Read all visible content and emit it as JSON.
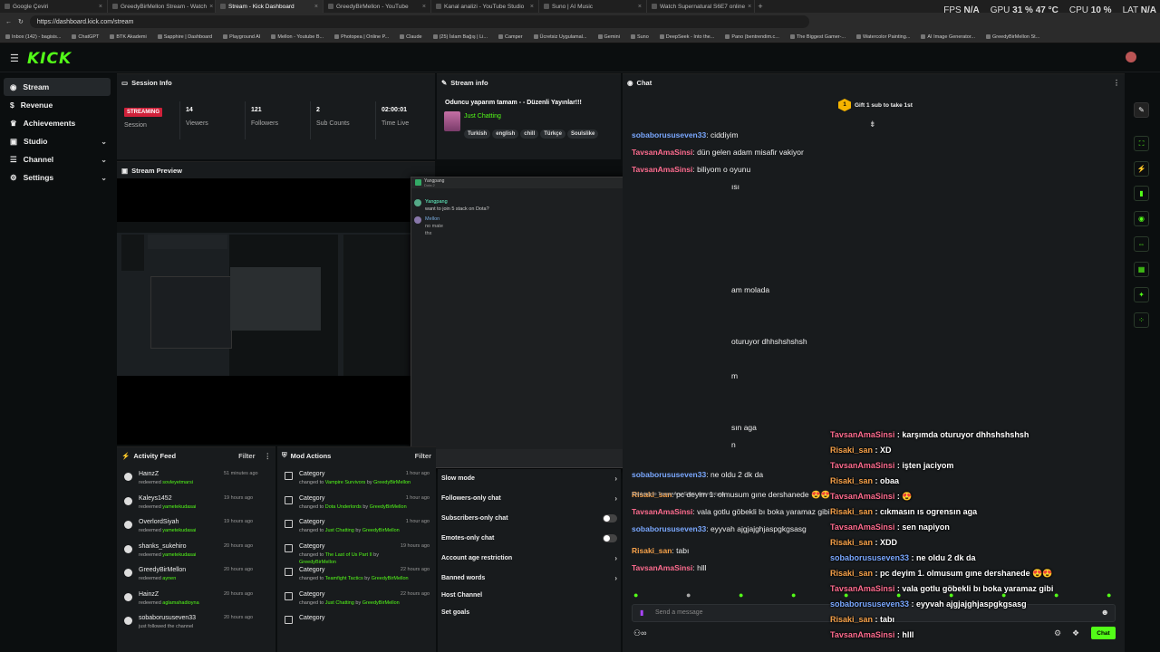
{
  "browser": {
    "tabs": [
      "Google Çeviri",
      "GreedyBirMellon Stream - Watch",
      "Stream - Kick Dashboard",
      "GreedyBirMellon - YouTube",
      "Kanal analizi - YouTube Studio",
      "Suno | AI Music",
      "Watch Supernatural S6E7 online"
    ],
    "url": "https://dashboard.kick.com/stream",
    "bookmarks": [
      "Inbox (142) - bagisis...",
      "ChatGPT",
      "BTK Akademi",
      "Sapphire | Dashboard",
      "Playground AI",
      "Mellon - Youtube B...",
      "Photopea | Online P...",
      "Claude",
      "(25) İslam Bağış | Li...",
      "Camper",
      "Ücretsiz Uygulamal...",
      "Gemini",
      "Suno",
      "DeepSeek - Into the...",
      "Pano (bentrendim.c...",
      "The Biggest Gamer-...",
      "Watercolor Painting...",
      "AI Image Generator...",
      "GreedyBirMellon St..."
    ],
    "perf": {
      "fps_label": "FPS",
      "fps": "N/A",
      "gpu_label": "GPU",
      "gpu": "31 % 47 °C",
      "cpu_label": "CPU",
      "cpu": "10 %",
      "lat_label": "LAT",
      "lat": "N/A"
    }
  },
  "app": {
    "logo": "KICK"
  },
  "sidebar": [
    {
      "label": "Stream",
      "icon": "broadcast-icon"
    },
    {
      "label": "Revenue",
      "icon": "revenue-icon"
    },
    {
      "label": "Achievements",
      "icon": "trophy-icon"
    },
    {
      "label": "Studio",
      "icon": "studio-icon"
    },
    {
      "label": "Channel",
      "icon": "channel-icon"
    },
    {
      "label": "Settings",
      "icon": "gear-icon"
    }
  ],
  "session": {
    "title": "Session Info",
    "status": "STREAMING",
    "status_label": "Session",
    "viewers": "14",
    "viewers_label": "Viewers",
    "followers": "121",
    "followers_label": "Followers",
    "subs": "2",
    "subs_label": "Sub Counts",
    "time": "02:00:01",
    "time_label": "Time Live"
  },
  "stream_info": {
    "title": "Stream info",
    "stream_title": "Oduncu yaparım tamam - - Düzenli Yayınlar!!!",
    "category": "Just Chatting",
    "tags": [
      "Turkish",
      "english",
      "chill",
      "Türkçe",
      "Soulslike"
    ]
  },
  "preview": {
    "title": "Stream Preview"
  },
  "popup": {
    "header_name": "Yangpang",
    "header_sub": "Dota 2",
    "messages": [
      {
        "user": "Yangpang",
        "text": "want to join 5 stack on Dota?"
      },
      {
        "user": "Mellon",
        "text": "no mate"
      },
      {
        "user": "",
        "text": "thx"
      }
    ]
  },
  "activity": {
    "title": "Activity Feed",
    "filter": "Filter",
    "items": [
      {
        "name": "HainzZ",
        "action": "redeemed",
        "reward": "sovleyetmarsi",
        "time": "51 minutes ago"
      },
      {
        "name": "Kaleys1452",
        "action": "redeemed",
        "reward": "yametekudasai",
        "time": "19 hours ago"
      },
      {
        "name": "OverlordSiyah",
        "action": "redeemed",
        "reward": "yametekudasai",
        "time": "19 hours ago"
      },
      {
        "name": "shanks_sukehiro",
        "action": "redeemed",
        "reward": "yametekudasai",
        "time": "20 hours ago"
      },
      {
        "name": "GreedyBirMellon",
        "action": "redeemed",
        "reward": "aynen",
        "time": "20 hours ago"
      },
      {
        "name": "HainzZ",
        "action": "redeemed",
        "reward": "aglamahadioyna",
        "time": "20 hours ago"
      },
      {
        "name": "sobaborususeven33",
        "action": "just followed the channel",
        "reward": "",
        "time": "20 hours ago"
      }
    ]
  },
  "mod_actions": {
    "title": "Mod Actions",
    "filter": "Filter",
    "items": [
      {
        "name": "Category",
        "line1": "changed to",
        "target": "Vampire Survivors",
        "line2": "by",
        "by": "GreedyBirMellon",
        "time": "1 hour ago"
      },
      {
        "name": "Category",
        "line1": "changed to",
        "target": "Dota Underlords",
        "line2": "by",
        "by": "GreedyBirMellon",
        "time": "1 hour ago"
      },
      {
        "name": "Category",
        "line1": "changed to",
        "target": "Just Chatting",
        "line2": "by",
        "by": "GreedyBirMellon",
        "time": "1 hour ago"
      },
      {
        "name": "Category",
        "line1": "changed to",
        "target": "The Last of Us Part II",
        "line2": "by",
        "by": "GreedyBirMellon",
        "time": "19 hours ago"
      },
      {
        "name": "Category",
        "line1": "changed to",
        "target": "Teamfight Tactics",
        "line2": "by",
        "by": "GreedyBirMellon",
        "time": "22 hours ago"
      },
      {
        "name": "Category",
        "line1": "changed to",
        "target": "Just Chatting",
        "line2": "by",
        "by": "GreedyBirMellon",
        "time": "22 hours ago"
      },
      {
        "name": "Category",
        "line1": "",
        "target": "",
        "line2": "",
        "by": "",
        "time": ""
      }
    ]
  },
  "chat_settings": [
    "Slow mode",
    "Followers-only chat",
    "Subscribers-only chat",
    "Emotes-only chat",
    "Account age restriction",
    "Banned words",
    "Host Channel",
    "Set goals"
  ],
  "chat": {
    "title": "Chat",
    "gift_badge": "1",
    "gift_text": "Gift 1 sub to take 1st",
    "messages": [
      {
        "user": "sobaborususeven33",
        "color": "blue",
        "text": "ciddiyim"
      },
      {
        "user": "TavsanAmaSinsi",
        "color": "pink",
        "text": "dün gelen adam misafir vakiyor"
      },
      {
        "user": "TavsanAmaSinsi",
        "color": "pink",
        "text": "biliyom o oyunu"
      },
      {
        "user": "",
        "color": "",
        "text": "ısı"
      },
      {
        "user": "",
        "color": "",
        "text": "am molada"
      },
      {
        "user": "",
        "color": "",
        "text": "oturuyor dhhshshshsh"
      },
      {
        "user": "",
        "color": "",
        "text": "m"
      },
      {
        "user": "",
        "color": "",
        "text": "sın aga"
      },
      {
        "user": "",
        "color": "",
        "text": "n"
      },
      {
        "user": "sobaborususeven33",
        "color": "blue",
        "text": "ne oldu 2 dk da"
      },
      {
        "user": "Risaki_san",
        "color": "orange",
        "text": "pc deyim 1. olmusum gıne dershanede 😍😍"
      },
      {
        "user": "TavsanAmaSinsi",
        "color": "pink",
        "text": "vala gotlu göbekli bı boka yaramaz gibi"
      },
      {
        "user": "sobaborususeven33",
        "color": "blue",
        "text": "eyyvah ajgjajghjaspgkgsasg"
      },
      {
        "user": "Risaki_san",
        "color": "orange",
        "text": "tabı"
      },
      {
        "user": "TavsanAmaSinsi",
        "color": "pink",
        "text": "hlll"
      }
    ],
    "reply_note": "Replying to TavsanAmaSinsi: sen napiyon",
    "input_placeholder": "Send a message",
    "send_label": "Chat"
  },
  "overlay": [
    {
      "user": "TavsanAmaSinsi",
      "color": "pink",
      "text": "karşımda oturuyor dhhshshshsh"
    },
    {
      "user": "Risaki_san",
      "color": "orange",
      "text": "XD"
    },
    {
      "user": "TavsanAmaSinsi",
      "color": "pink",
      "text": "işten jaciyom"
    },
    {
      "user": "Risaki_san",
      "color": "orange",
      "text": "obaa"
    },
    {
      "user": "TavsanAmaSinsi",
      "color": "pink",
      "text": "😍"
    },
    {
      "user": "Risaki_san",
      "color": "orange",
      "text": "cıkmasın ıs ogrensın aga"
    },
    {
      "user": "TavsanAmaSinsi",
      "color": "pink",
      "text": "sen napiyon"
    },
    {
      "user": "Risaki_san",
      "color": "orange",
      "text": "XDD"
    },
    {
      "user": "sobaborususeven33",
      "color": "blue",
      "text": "ne oldu 2 dk da"
    },
    {
      "user": "Risaki_san",
      "color": "orange",
      "text": "pc deyim 1. olmusum gıne dershanede 😍😍"
    },
    {
      "user": "TavsanAmaSinsi",
      "color": "pink",
      "text": "vala gotlu göbekli bı boka yaramaz gibi"
    },
    {
      "user": "sobaborususeven33",
      "color": "blue",
      "text": "eyyvah ajgjajghjaspgkgsasg"
    },
    {
      "user": "Risaki_san",
      "color": "orange",
      "text": "tabı"
    },
    {
      "user": "TavsanAmaSinsi",
      "color": "pink",
      "text": "hlll"
    }
  ],
  "right_tools": [
    "edit-icon",
    "fullscreen-icon",
    "bolt-icon",
    "trash-icon",
    "chat-icon",
    "link-icon",
    "calendar-icon",
    "wrench-icon",
    "dots-icon"
  ],
  "colors": {
    "accent": "#53fc18",
    "live": "#d0213a",
    "bg": "#0b0e0f",
    "panel": "#181b1d"
  }
}
